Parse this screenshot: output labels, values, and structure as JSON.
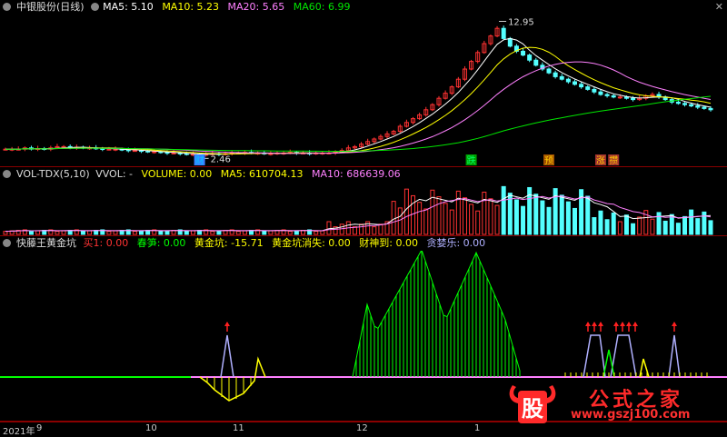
{
  "main": {
    "name": "中银股份(日线)",
    "ma5": "MA5: 5.10",
    "ma10": "MA10: 5.23",
    "ma20": "MA20: 5.65",
    "ma60": "MA60: 6.99",
    "high_label": "12.95",
    "low_label": "2.46",
    "markers": [
      "财",
      "跌",
      "预",
      "涨",
      "攒"
    ],
    "close_icon": "close-icon"
  },
  "volume": {
    "name": "VOL-TDX(5,10)",
    "vvol": "VVOL: -",
    "volume": "VOLUME: 0.00",
    "ma5": "MA5: 610704.13",
    "ma10": "MA10: 686639.06"
  },
  "indicator": {
    "name": "快藤王黄金坑",
    "buy": "买1: 0.00",
    "spring": "春笋: 0.00",
    "gold_pit": "黄金坑: -15.71",
    "gold_pit_gone": "黄金坑消失: 0.00",
    "wealth": "财神到: 0.00",
    "greedy": "贪婪乐: 0.00"
  },
  "xaxis": {
    "ticks": [
      "2021年",
      "9",
      "10",
      "11",
      "12",
      "1"
    ]
  },
  "watermark": {
    "title": "公式之家",
    "url": "www.gszj100.com",
    "logo_char": "股"
  },
  "colors": {
    "background": "#000000",
    "up": "#ff3232",
    "down": "#54ffff",
    "ma5": "#ffffff",
    "ma10": "#ffff00",
    "ma20": "#ff80ff",
    "ma60": "#00e600",
    "indicator_green": "#00ff00",
    "indicator_yellow": "#ffff00"
  },
  "chart_data": [
    {
      "type": "candlestick",
      "title": "中银股份(日线)",
      "x_ticks": [
        "2021年",
        "9",
        "10",
        "11",
        "12",
        "1"
      ],
      "series": [
        {
          "name": "MA5",
          "values": [
            5.1
          ]
        },
        {
          "name": "MA10",
          "values": [
            5.23
          ]
        },
        {
          "name": "MA20",
          "values": [
            5.65
          ]
        },
        {
          "name": "MA60",
          "values": [
            6.99
          ]
        }
      ],
      "annotations": [
        "12.95",
        "2.46"
      ],
      "price_close": [
        2.9,
        2.9,
        2.9,
        3.0,
        2.9,
        2.95,
        2.9,
        3.0,
        3.1,
        3.1,
        3.0,
        3.05,
        3.0,
        3.0,
        2.95,
        2.9,
        2.9,
        2.9,
        2.85,
        2.8,
        2.8,
        2.75,
        2.7,
        2.7,
        2.65,
        2.6,
        2.6,
        2.55,
        2.5,
        2.5,
        2.46,
        2.5,
        2.55,
        2.5,
        2.55,
        2.6,
        2.6,
        2.65,
        2.6,
        2.6,
        2.55,
        2.55,
        2.6,
        2.6,
        2.65,
        2.6,
        2.6,
        2.55,
        2.6,
        2.6,
        2.6,
        2.7,
        2.8,
        3.0,
        3.1,
        3.3,
        3.5,
        3.7,
        3.9,
        4.1,
        4.3,
        4.7,
        5.0,
        5.3,
        5.6,
        6.0,
        6.4,
        6.9,
        7.3,
        7.8,
        8.4,
        9.2,
        9.8,
        10.5,
        11.2,
        11.8,
        12.4,
        11.6,
        11.0,
        10.6,
        10.3,
        9.9,
        9.5,
        9.2,
        8.9,
        8.6,
        8.4,
        8.2,
        8.0,
        7.8,
        7.6,
        7.4,
        7.2,
        7.1,
        7.0,
        7.0,
        6.9,
        6.8,
        6.9,
        7.1,
        7.2,
        7.0,
        6.8,
        6.6,
        6.5,
        6.4,
        6.3,
        6.2,
        6.1,
        6.0
      ]
    },
    {
      "type": "bar",
      "title": "VOL-TDX(5,10)",
      "series": [
        {
          "name": "VOLUME",
          "values": [
            0.0
          ]
        },
        {
          "name": "MA5",
          "values": [
            610704.13
          ]
        },
        {
          "name": "MA10",
          "values": [
            686639.06
          ]
        }
      ]
    },
    {
      "type": "bar",
      "title": "快藤王黄金坑",
      "series": [
        {
          "name": "买1",
          "values": [
            0.0
          ]
        },
        {
          "name": "春笋",
          "values": [
            0.0
          ]
        },
        {
          "name": "黄金坑",
          "values": [
            -15.71
          ]
        },
        {
          "name": "黄金坑消失",
          "values": [
            0.0
          ]
        },
        {
          "name": "财神到",
          "values": [
            0.0
          ]
        },
        {
          "name": "贪婪乐",
          "values": [
            0.0
          ]
        }
      ]
    }
  ]
}
